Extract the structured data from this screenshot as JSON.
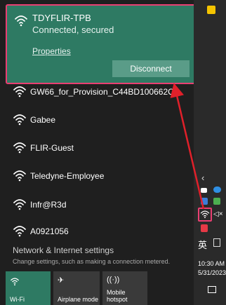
{
  "connected": {
    "ssid": "TDYFLIR-TPB",
    "status": "Connected, secured",
    "properties_label": "Properties",
    "disconnect_label": "Disconnect"
  },
  "networks": [
    {
      "name": "GW66_for_Provision_C44BD100662C",
      "secured": false
    },
    {
      "name": "Gabee",
      "secured": false
    },
    {
      "name": "FLIR-Guest",
      "secured": false
    },
    {
      "name": "Teledyne-Employee",
      "secured": false
    },
    {
      "name": "Infr@R3d",
      "secured": false
    },
    {
      "name": "A0921056",
      "secured": false
    }
  ],
  "settings": {
    "title": "Network & Internet settings",
    "subtitle": "Change settings, such as making a connection metered."
  },
  "tiles": {
    "wifi": "Wi-Fi",
    "airplane": "Airplane mode",
    "hotspot_line1": "Mobile",
    "hotspot_line2": "hotspot"
  },
  "taskbar": {
    "language": "英",
    "time": "10:30 AM",
    "date": "5/31/2023"
  },
  "colors": {
    "accent": "#2e7a63",
    "highlight_border": "#ea3f72",
    "arrow": "#e0202a"
  }
}
